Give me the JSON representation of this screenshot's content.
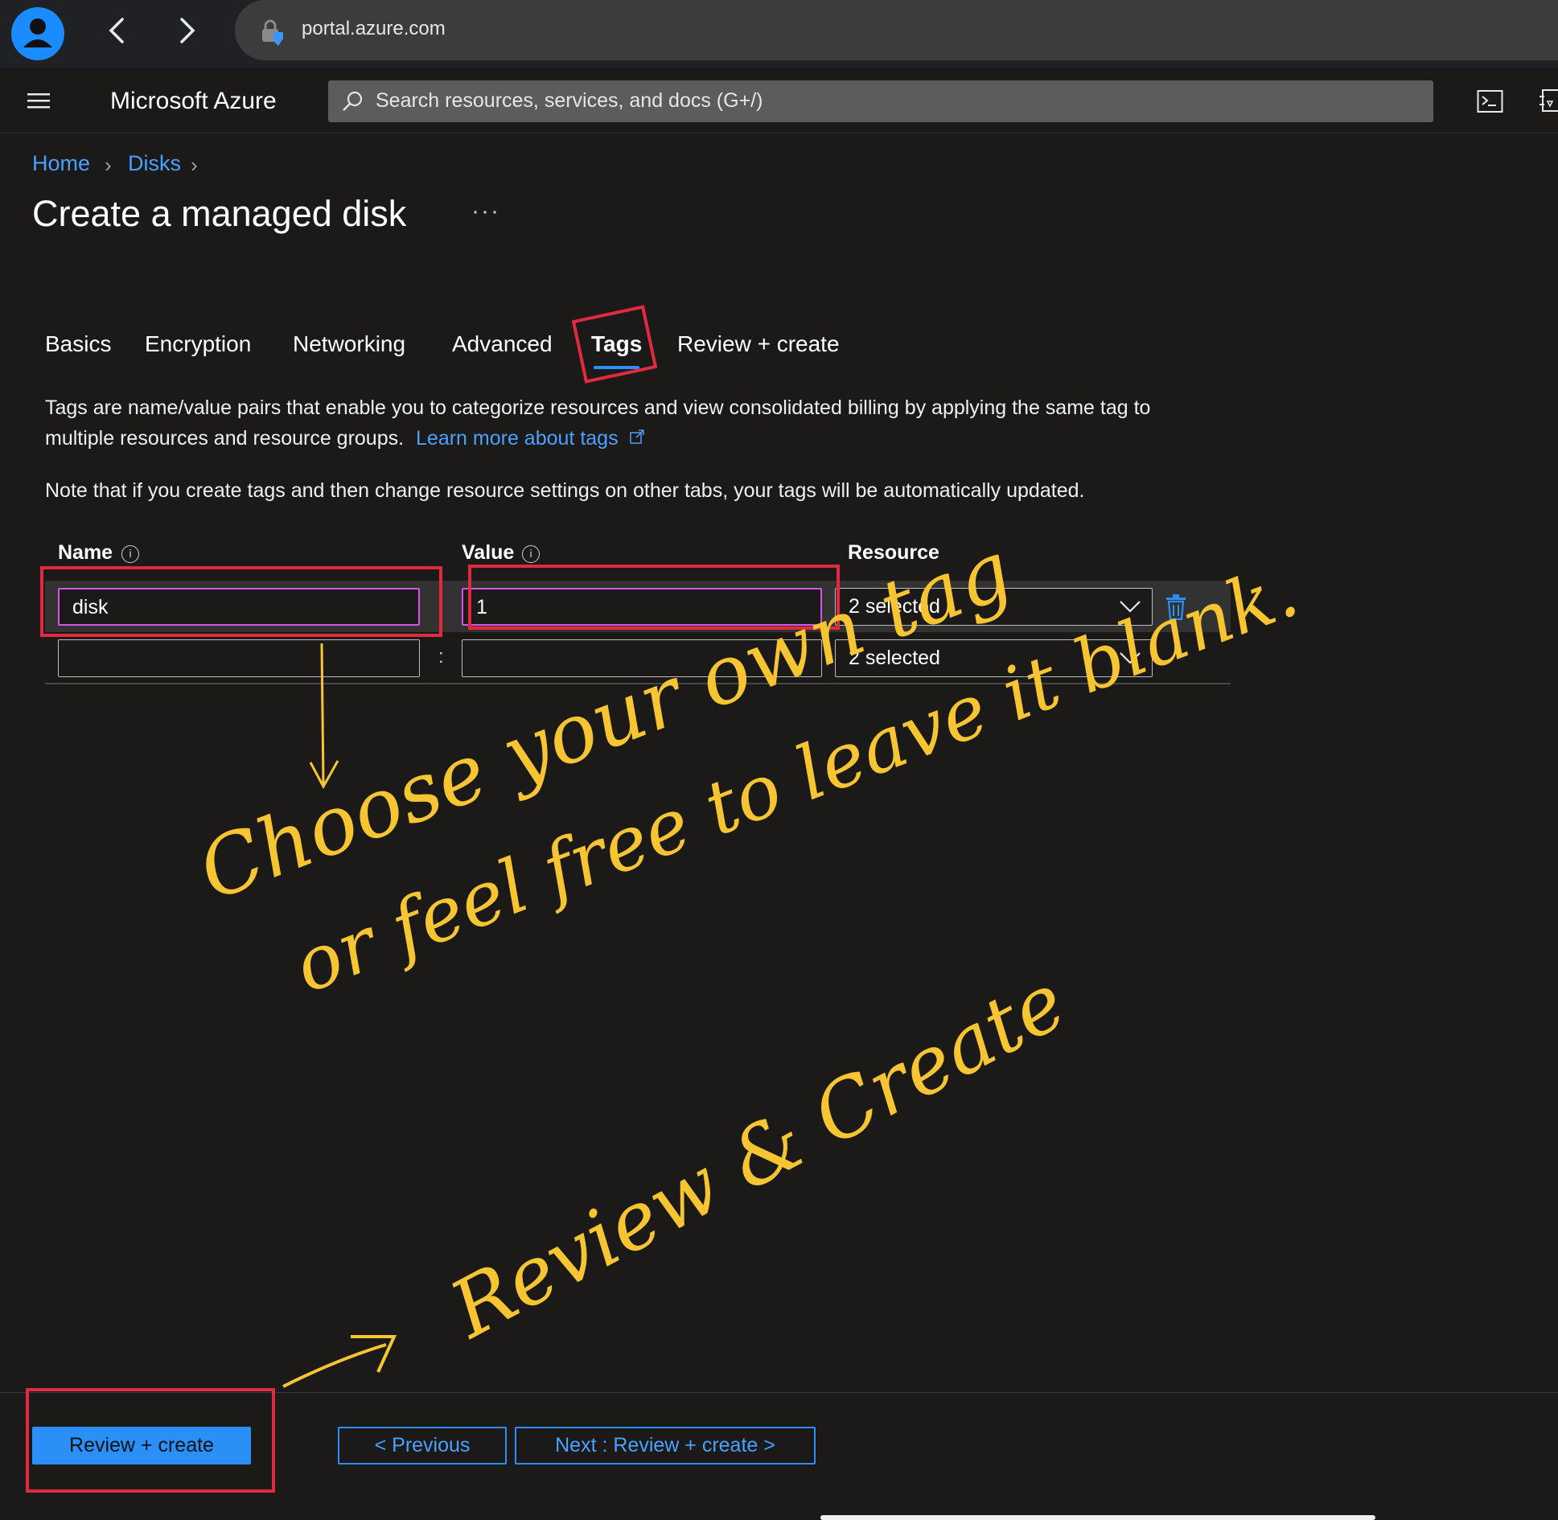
{
  "browser": {
    "url": "portal.azure.com"
  },
  "header": {
    "brand": "Microsoft Azure",
    "search_placeholder": "Search resources, services, and docs (G+/)"
  },
  "breadcrumb": [
    {
      "label": "Home"
    },
    {
      "label": "Disks"
    }
  ],
  "page": {
    "title": "Create a managed disk",
    "more": "···"
  },
  "tabs": [
    {
      "label": "Basics"
    },
    {
      "label": "Encryption"
    },
    {
      "label": "Networking"
    },
    {
      "label": "Advanced"
    },
    {
      "label": "Tags",
      "active": true
    },
    {
      "label": "Review + create"
    }
  ],
  "description": {
    "line1": "Tags are name/value pairs that enable you to categorize resources and view consolidated billing by applying the same tag to",
    "line2": "multiple resources and resource groups.",
    "link": "Learn more about tags",
    "note": "Note that if you create tags and then change resource settings on other tabs, your tags will be automatically updated."
  },
  "table": {
    "headers": {
      "name": "Name",
      "value": "Value",
      "resource": "Resource"
    },
    "separator": ":",
    "rows": [
      {
        "name": "disk",
        "value": "1",
        "resource": "2 selected"
      },
      {
        "name": "",
        "value": "",
        "resource": "2 selected"
      }
    ]
  },
  "footer": {
    "review_create": "Review + create",
    "previous": "< Previous",
    "next": "Next : Review + create >"
  },
  "annotations": {
    "note1": "Choose your own tag",
    "note2": "or feel free to leave it blank.",
    "note3": "Review & Create"
  },
  "colors": {
    "accent": "#2a8ff7",
    "link": "#4aa0ff",
    "highlight": "#e02a3f",
    "handwriting": "#f7c531",
    "focus": "#d655e6"
  },
  "icons": [
    "profile-icon",
    "back-arrow-icon",
    "forward-arrow-icon",
    "site-info-icon",
    "hamburger-menu-icon",
    "search-icon",
    "cloud-shell-icon",
    "directory-filter-icon",
    "chevron-right-icon",
    "external-link-icon",
    "info-icon",
    "chevron-down-icon",
    "trash-icon"
  ]
}
